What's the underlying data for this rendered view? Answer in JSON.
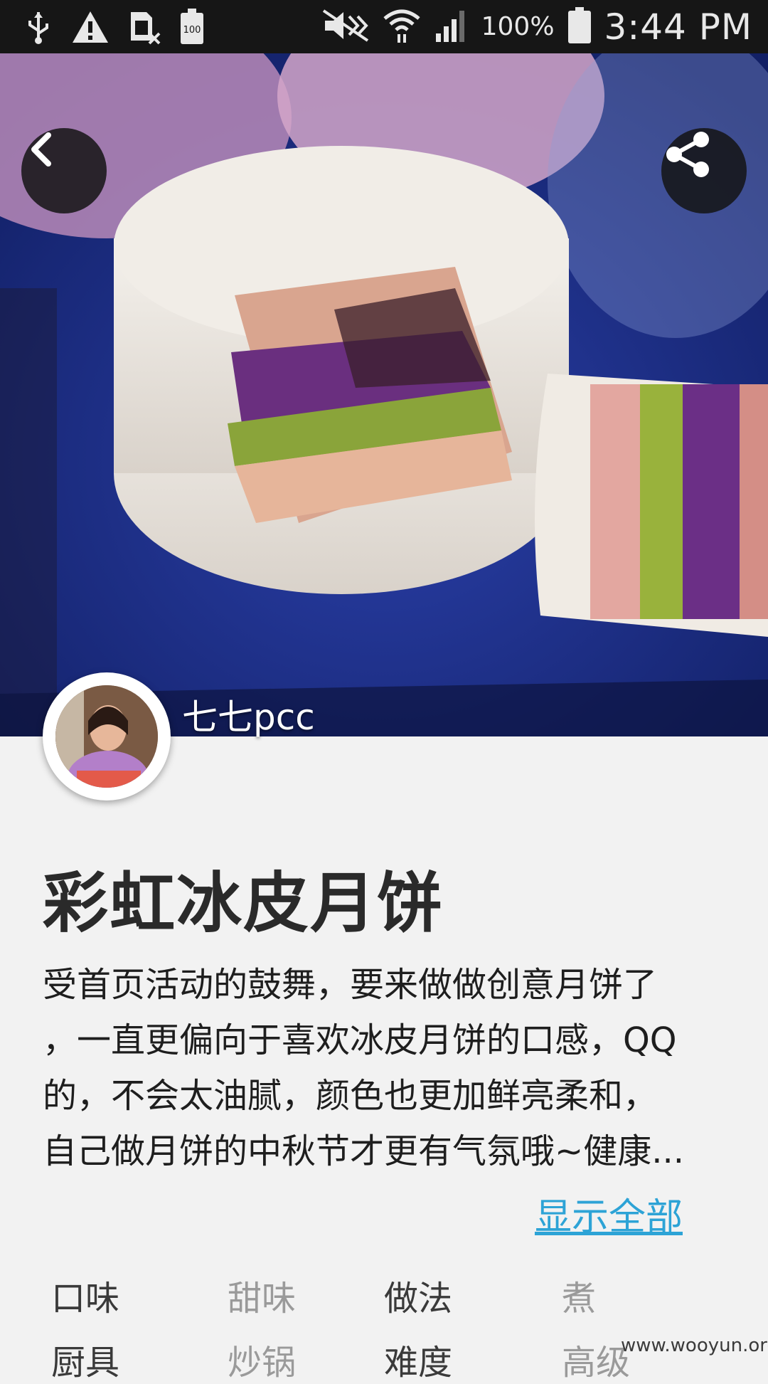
{
  "status_bar": {
    "icons": [
      "usb-icon",
      "warning-icon",
      "sim-off-icon",
      "battery-saver-icon",
      "mute-icon",
      "wifi-icon",
      "signal-icon",
      "battery-icon"
    ],
    "battery_saver_text": "100",
    "battery_percent": "100%",
    "time": "3:44 PM"
  },
  "hero": {
    "author_name": "七七pcc",
    "accent_colors": {
      "plate": "#1b2f8a",
      "mooncake": "#ece7e1"
    }
  },
  "recipe": {
    "title": "彩虹冰皮月饼",
    "description_lines": [
      "受首页活动的鼓舞，要来做做创意月饼了",
      "，一直更偏向于喜欢冰皮月饼的口感，QQ",
      "的，不会太油腻，颜色也更加鲜亮柔和，",
      "自己做月饼的中秋节才更有气氛哦~健康..."
    ],
    "show_all_label": "显示全部",
    "attributes": [
      {
        "key": "口味",
        "value": "甜味"
      },
      {
        "key": "做法",
        "value": "煮"
      },
      {
        "key": "厨具",
        "value": "炒锅"
      },
      {
        "key": "难度",
        "value": "高级"
      }
    ]
  },
  "watermark": "www.wooyun.org",
  "colors": {
    "link": "#2da3d6",
    "status_bar_bg": "#161616",
    "page_bg": "#f2f2f2"
  }
}
